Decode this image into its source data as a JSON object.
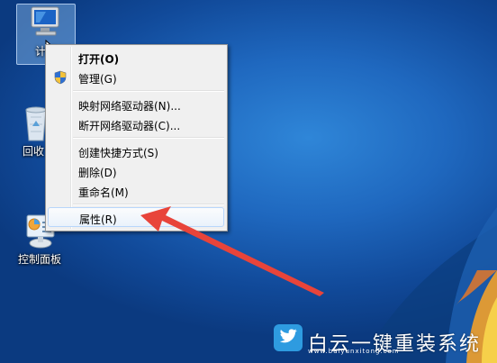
{
  "desktop_icons": [
    {
      "name": "computer",
      "label": "计算机",
      "visible_label": "计算"
    },
    {
      "name": "recycle-bin",
      "label": "回收站",
      "visible_label": "回收"
    },
    {
      "name": "control-panel",
      "label": "控制面板",
      "visible_label": "控制面板"
    }
  ],
  "context_menu": {
    "items": [
      {
        "label": "打开(O)",
        "bold": true
      },
      {
        "label": "管理(G)",
        "icon": "uac-shield-icon"
      },
      {
        "label": "映射网络驱动器(N)..."
      },
      {
        "label": "断开网络驱动器(C)..."
      },
      {
        "label": "创建快捷方式(S)"
      },
      {
        "label": "删除(D)"
      },
      {
        "label": "重命名(M)"
      },
      {
        "label": "属性(R)",
        "highlighted": true
      }
    ]
  },
  "watermark": {
    "text": "白云一键重装系统",
    "url": "www.baiyunxitong.com"
  },
  "colors": {
    "desktop": "#1f68bf",
    "menu_bg": "#f0f0f0",
    "arrow": "#e8443a"
  }
}
